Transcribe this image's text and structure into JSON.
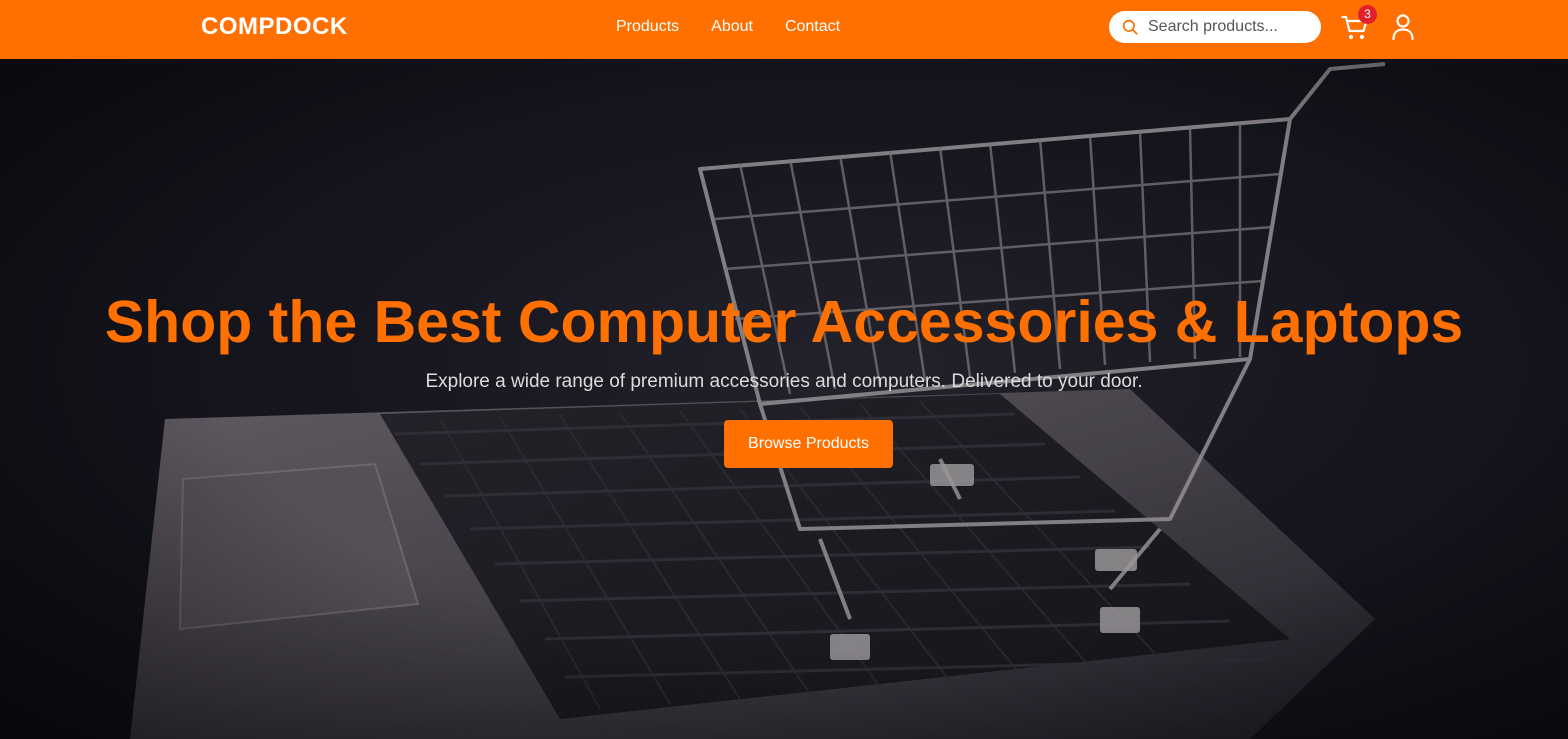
{
  "brand": {
    "name": "COMPDOCK"
  },
  "nav": {
    "links": [
      {
        "label": "Products"
      },
      {
        "label": "About"
      },
      {
        "label": "Contact"
      }
    ]
  },
  "search": {
    "placeholder": "Search products...",
    "value": ""
  },
  "cart": {
    "count": "3",
    "icon": "cart-icon"
  },
  "user": {
    "icon": "user-icon"
  },
  "hero": {
    "title": "Shop the Best Computer Accessories & Laptops",
    "subtitle": "Explore a wide range of premium accessories and computers. Delivered to your door.",
    "cta_label": "Browse Products",
    "background": "photo of a laptop keyboard with a miniature shopping cart"
  },
  "colors": {
    "accent": "#ff7000",
    "badge": "#e0202a",
    "hero_dark": "#141218"
  }
}
